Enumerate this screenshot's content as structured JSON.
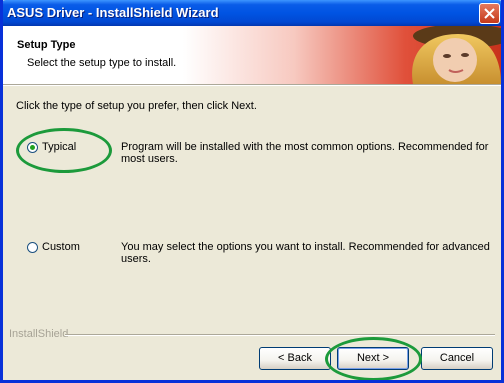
{
  "window": {
    "title": "ASUS Driver - InstallShield Wizard"
  },
  "header": {
    "title": "Setup Type",
    "subtitle": "Select the setup type to install."
  },
  "instruction": "Click the type of setup you prefer, then click Next.",
  "options": [
    {
      "label": "Typical",
      "selected": true,
      "description": "Program will be installed with the most common options.  Recommended for most users."
    },
    {
      "label": "Custom",
      "selected": false,
      "description": "You may select the options you want to install. Recommended for advanced users."
    }
  ],
  "footer": {
    "group_label": "InstallShield"
  },
  "buttons": {
    "back": "< Back",
    "next": "Next >",
    "cancel": "Cancel"
  },
  "colors": {
    "titlebar": "#0054e3",
    "annotation_circle": "#1c9a3b",
    "radio_dot": "#21a121"
  },
  "icons": [
    "close-icon",
    "header-artwork"
  ]
}
